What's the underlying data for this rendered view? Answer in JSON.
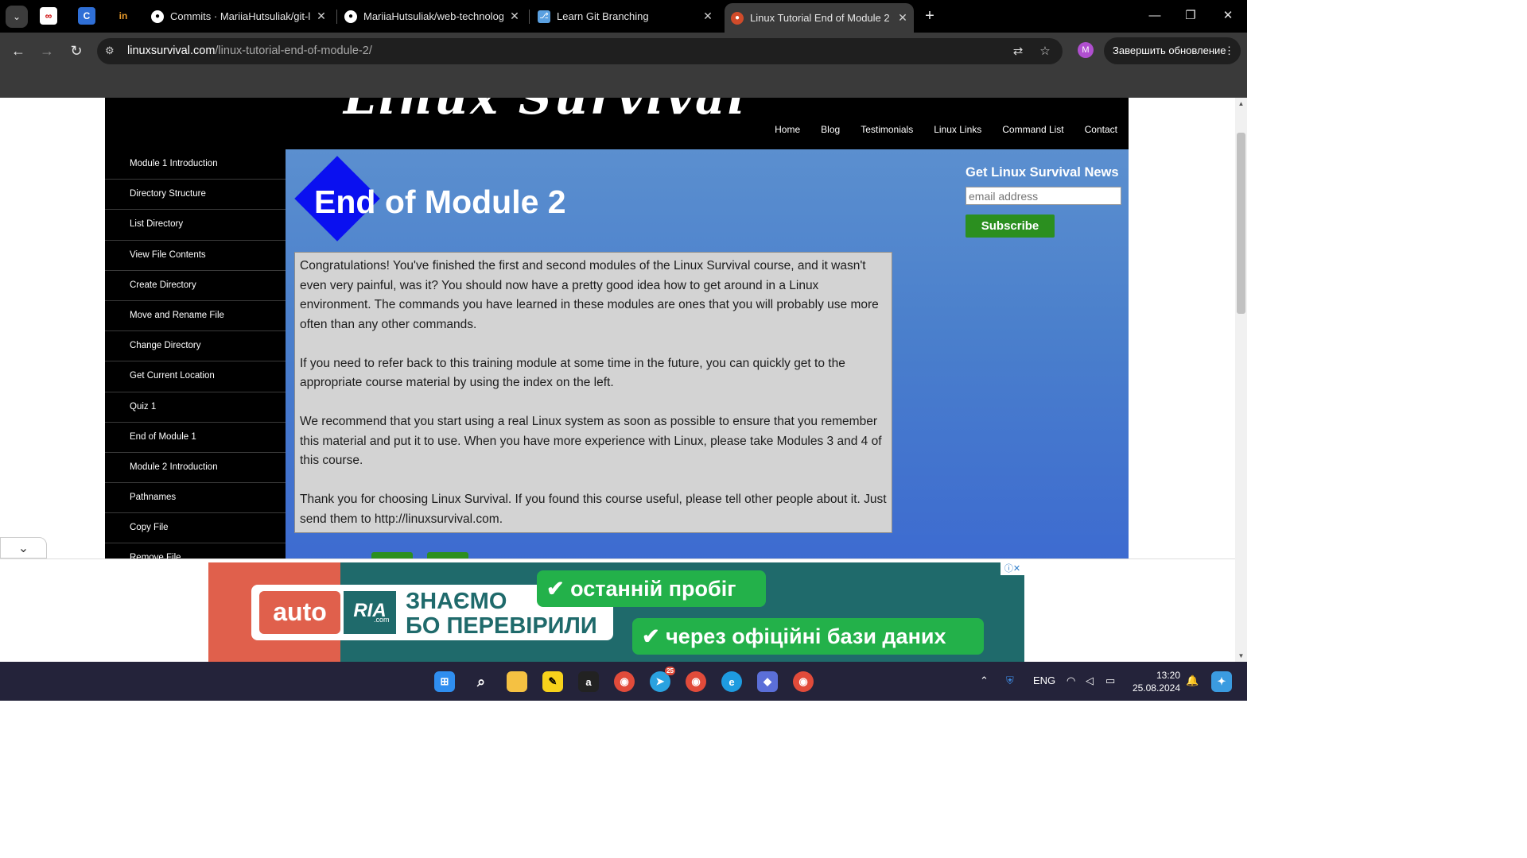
{
  "browser": {
    "tabs": [
      {
        "title": "Commits · MariiaHutsuliak/git-l",
        "favicon": "github-icon"
      },
      {
        "title": "MariiaHutsuliak/web-technolog",
        "favicon": "github-icon"
      },
      {
        "title": "Learn Git Branching",
        "favicon": "learngit-icon"
      },
      {
        "title": "Linux Tutorial End of Module 2",
        "favicon": "linuxsurvival-icon",
        "active": true
      }
    ],
    "url_domain": "linuxsurvival.com",
    "url_path": "/linux-tutorial-end-of-module-2/",
    "profile_initial": "M",
    "update_button": "Завершить обновление"
  },
  "site": {
    "nav": [
      "Home",
      "Blog",
      "Testimonials",
      "Linux Links",
      "Command List",
      "Contact"
    ],
    "sidebar": [
      "Module 1 Introduction",
      "Directory Structure",
      "List Directory",
      "View File Contents",
      "Create Directory",
      "Move and Rename File",
      "Change Directory",
      "Get Current Location",
      "Quiz 1",
      "End of Module 1",
      "Module 2 Introduction",
      "Pathnames",
      "Copy File",
      "Remove File"
    ],
    "page_title": "End of Module 2",
    "paragraphs": [
      "Congratulations! You've finished the first and second modules of the Linux Survival course, and it wasn't even very painful, was it? You should now have a pretty good idea how to get around in a Linux environment. The commands you have learned in these modules are ones that you will probably use more often than any other commands.",
      "If you need to refer back to this training module at some time in the future, you can quickly get to the appropriate course material by using the index on the left.",
      "We recommend that you start using a real Linux system as soon as possible to ensure that you remember this material and put it to use. When you have more experience with Linux, please take Modules 3 and 4 of this course.",
      "Thank you for choosing Linux Survival. If you found this course useful, please tell other people about it. Just send them to http://linuxsurvival.com."
    ],
    "newsletter": {
      "heading": "Get Linux Survival News",
      "placeholder": "email address",
      "button": "Subscribe"
    }
  },
  "ad": {
    "auto": "auto",
    "ria": "RIA",
    "ria_com": ".com",
    "slogan_line1": "ЗНАЄМО",
    "slogan_line2": "БО ПЕРЕВІРИЛИ",
    "pill1": "останній пробіг",
    "pill2": "через офіційні бази даних"
  },
  "taskbar": {
    "telegram_badge": "25",
    "lang": "ENG",
    "time": "13:20",
    "date": "25.08.2024"
  },
  "colors": {
    "content_bg": "#4a7fcc",
    "diamond": "#0a10f0",
    "subscribe": "#2b8f1f",
    "ad_green": "#23b14a",
    "ad_teal": "#1f6a6b",
    "ad_red": "#e0604c"
  }
}
